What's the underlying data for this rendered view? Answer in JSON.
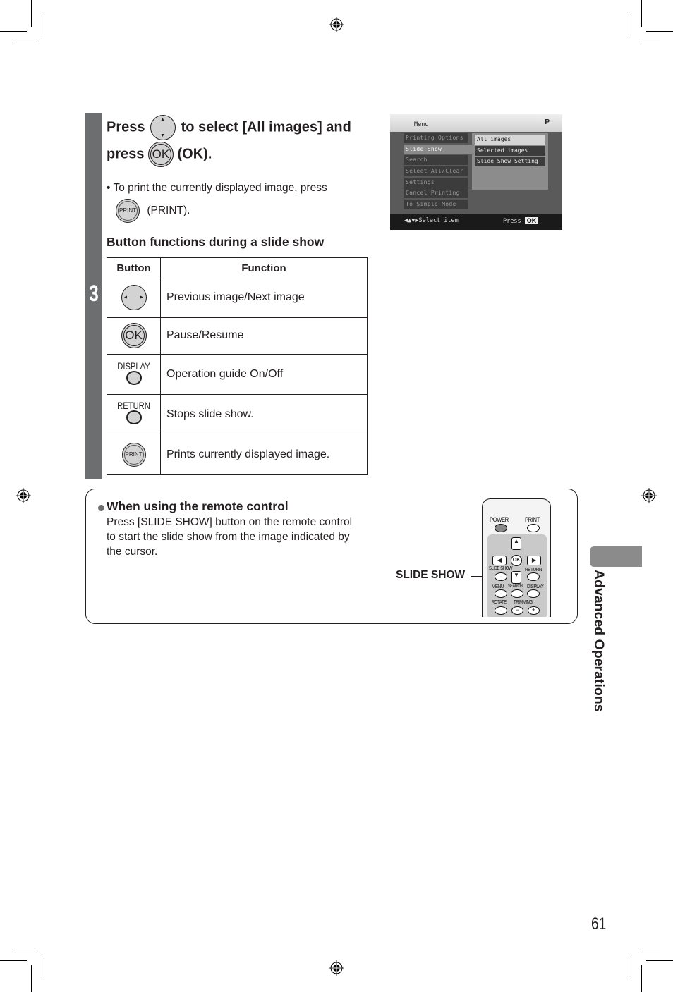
{
  "step": {
    "number": "3",
    "heading_part1": "Press",
    "heading_part2": "to select [All images] and",
    "heading_part3": "press",
    "heading_part4": "(OK).",
    "ok_glyph": "OK",
    "bullet": "To print the currently displayed image, press",
    "print_suffix": "(PRINT).",
    "print_glyph": "PRINT"
  },
  "table": {
    "title": "Button functions during a slide show",
    "headers": [
      "Button",
      "Function"
    ],
    "rows": [
      {
        "button": "left-right-button",
        "label": "",
        "function": "Previous image/Next image"
      },
      {
        "button": "ok-button",
        "label": "OK",
        "function": "Pause/Resume"
      },
      {
        "button": "display-button",
        "label": "DISPLAY",
        "function": "Operation guide On/Off"
      },
      {
        "button": "return-button",
        "label": "RETURN",
        "function": "Stops slide show."
      },
      {
        "button": "print-button",
        "label": "PRINT",
        "function": "Prints currently displayed image."
      }
    ]
  },
  "screen": {
    "title": "Menu",
    "corner_icon": "P",
    "menu_items": [
      "Printing Options",
      "Slide Show",
      "Search",
      "Select All/Clear",
      "Settings",
      "Cancel Printing",
      "To Simple Mode"
    ],
    "selected_menu": "Slide Show",
    "submenu_items": [
      "All images",
      "Selected images",
      "Slide Show Setting"
    ],
    "selected_submenu": "All images",
    "hint": "◀▲▼▶Select item",
    "press_label": "Press",
    "ok_badge": "OK"
  },
  "note": {
    "title": "When using the remote control",
    "body": "Press [SLIDE SHOW] button on the remote control to start the slide show from the image indicated by the cursor.",
    "callout": "SLIDE SHOW"
  },
  "remote": {
    "labels": {
      "power": "POWER",
      "print": "PRINT",
      "ok": "OK",
      "slideshow": "SLIDE SHOW",
      "return": "RETURN",
      "menu": "MENU",
      "search": "SEARCH",
      "display": "DISPLAY",
      "rotate": "ROTATE",
      "trimming": "TRIMMING",
      "minus": "−",
      "plus": "+"
    }
  },
  "side_tab": {
    "label": "Advanced Operations"
  },
  "page_number": "61"
}
